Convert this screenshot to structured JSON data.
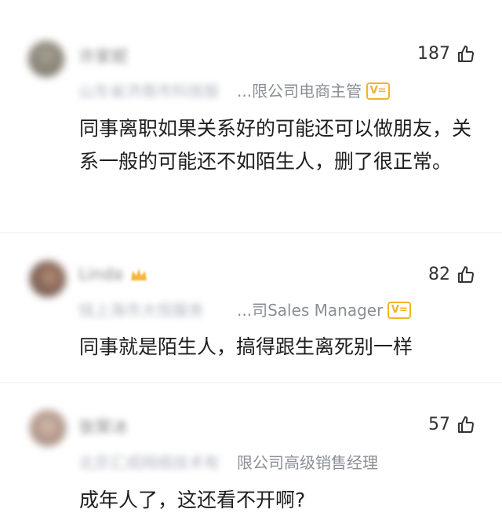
{
  "comments": [
    {
      "name": "许家妮",
      "job_hidden": "山东省济南市科技股",
      "job_visible": "...限公司电商主管",
      "likes": "187",
      "text": "同事离职如果关系好的可能还可以做朋友，关系一般的可能还不如陌生人，删了很正常。"
    },
    {
      "name": "Linda",
      "job_hidden": "钱上海市大恒服务",
      "job_visible": "...司Sales Manager",
      "likes": "82",
      "text": "同事就是陌生人，搞得跟生离死别一样"
    },
    {
      "name": "张荣冰",
      "job_hidden": "北京汇成网络技术有",
      "job_visible": "限公司高级销售经理",
      "likes": "57",
      "text": "成年人了，这还看不开啊?"
    }
  ],
  "badge_label": "V=",
  "colors": {
    "accent_badge": "#f0b429",
    "job_text": "#8a8f96",
    "divider": "#ececec"
  }
}
